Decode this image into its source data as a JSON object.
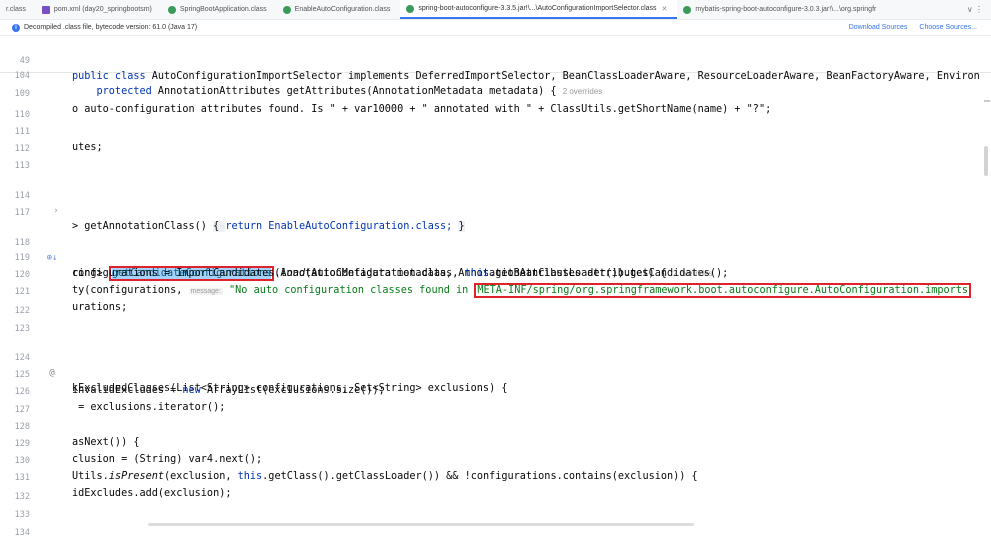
{
  "tabs": [
    {
      "label": "r.class",
      "color": "#e3a133",
      "active": false
    },
    {
      "label": "pom.xml (day20_springbootsm)",
      "color": "#7a4fc4",
      "active": false
    },
    {
      "label": "SpringBootApplication.class",
      "color": "#3a9a5a",
      "active": false
    },
    {
      "label": "EnableAutoConfiguration.class",
      "color": "#3a9a5a",
      "active": false
    },
    {
      "label": "spring-boot-autoconfigure-3.3.5.jar!\\...\\AutoConfigurationImportSelector.class",
      "color": "#3a9a5a",
      "active": true
    },
    {
      "label": "mybatis-spring-boot-autoconfigure-3.0.3.jar!\\...\\org.springfr",
      "color": "#3a9a5a",
      "active": false
    }
  ],
  "tab_more": "∨ ⋮",
  "banner": {
    "text": "Decompiled .class file, bytecode version: 61.0 (Java 17)",
    "download": "Download Sources",
    "choose": "Choose Sources..."
  },
  "sticky": {
    "l1": {
      "num": "49",
      "a": "public class ",
      "b": "AutoConfigurationImportSelector",
      "c": " implements DeferredImportSelector, BeanClassLoaderAware, ResourceLoaderAware, BeanFactoryAware, Environ"
    },
    "l2": {
      "num": "104",
      "a": "    protected ",
      "b": "AnnotationAttributes getAttributes(AnnotationMetadata metadata) {",
      "hint": "2 overrides"
    }
  },
  "lines": {
    "l109": {
      "num": "109",
      "text": "o auto-configuration attributes found. Is \" + var10000 + \" annotated with \" + ClassUtils.getShortName(name) + \"?\";"
    },
    "l110": {
      "num": "110"
    },
    "l111": {
      "num": "111",
      "text": "utes;"
    },
    "l112": {
      "num": "112"
    },
    "l113": {
      "num": "113"
    },
    "l114": {
      "num": "114",
      "fold": "›",
      "a": "> getAnnotationClass() ",
      "b": "{ ",
      "c": "return ",
      "d": "EnableAutoConfiguration",
      "e": ".class; ",
      "f": "}"
    },
    "l117": {
      "num": "117"
    },
    "l118": {
      "num": "118",
      "icon": "⊕↓",
      "a": "ring> ",
      "b": "getCandidateConfigurations",
      "c": "(AnnotationMetadata metadata, AnnotationAttributes attributes) {",
      "hint": "2 overrides"
    },
    "l119": {
      "num": "119",
      "a": "configurations = ImportCandidates.",
      "b": "load",
      "c": "(AutoConfiguration.class, ",
      "d": "this",
      "e": ".getBeanClassLoader()).getCandidates();"
    },
    "l120": {
      "num": "120",
      "a": "ty(configurations, ",
      "ptag": "message:",
      "b": " \"No auto configuration classes found in ",
      "c": "META-INF/spring/org.springframework.boot.autoconfigure.AutoConfiguration.imports"
    },
    "l121": {
      "num": "121",
      "text": "urations;"
    },
    "l122": {
      "num": "122"
    },
    "l123": {
      "num": "123"
    },
    "l124": {
      "num": "124",
      "icon": "@",
      "text": "kExcludedClasses(List<String> configurations, Set<String> exclusions) {"
    },
    "l125": {
      "num": "125",
      "a": "invalidExcludes = ",
      "b": "new",
      "c": " ArrayList(exclusions.size());"
    },
    "l126": {
      "num": "126",
      "text": " = exclusions.iterator();"
    },
    "l127": {
      "num": "127"
    },
    "l128": {
      "num": "128",
      "text": "asNext()) {"
    },
    "l129": {
      "num": "129",
      "text": "clusion = (String) var4.next();"
    },
    "l130": {
      "num": "130",
      "a": "Utils.",
      "b": "isPresent",
      "c": "(exclusion, ",
      "d": "this",
      "e": ".getClass().getClassLoader()) && !configurations.contains(exclusion)) {"
    },
    "l131": {
      "num": "131",
      "text": "idExcludes.add(exclusion);"
    },
    "l132": {
      "num": "132"
    },
    "l133": {
      "num": "133"
    },
    "l134": {
      "num": "134"
    }
  },
  "colors": {
    "keyword": "#0033b3",
    "string": "#067d17",
    "highlight_box": "#e0222a",
    "selection": "#a6d2ff",
    "accent": "#3574f0"
  }
}
